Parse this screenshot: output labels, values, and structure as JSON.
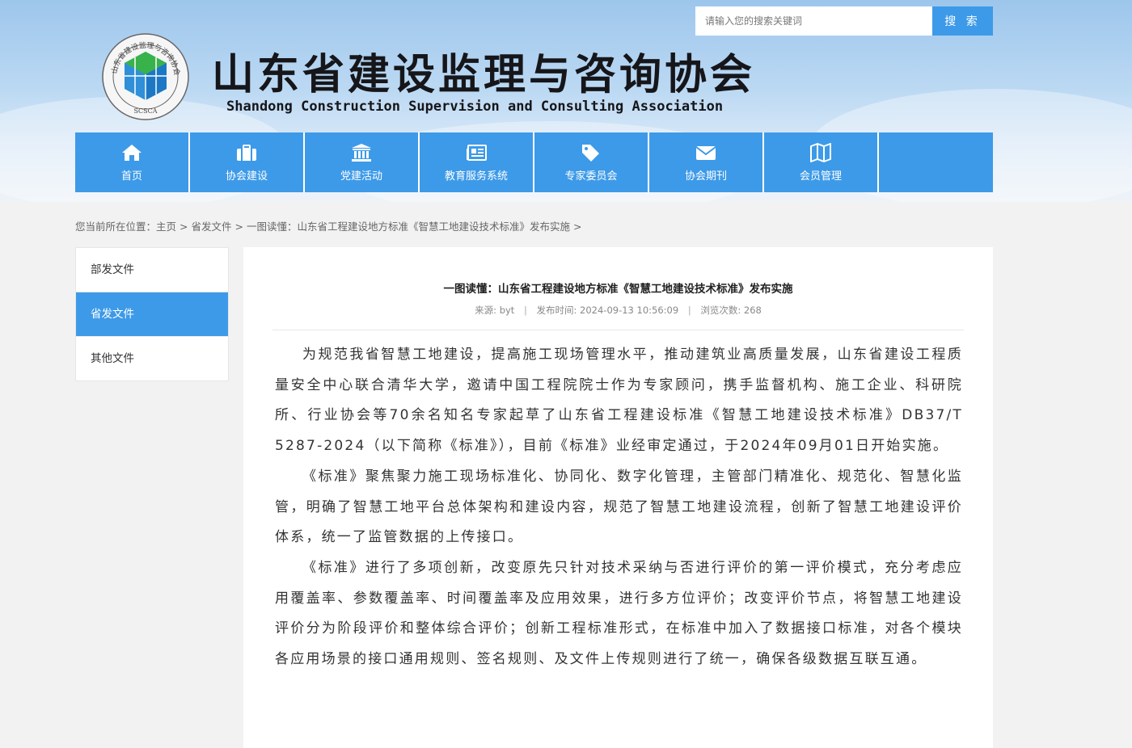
{
  "search": {
    "placeholder": "请输入您的搜索关键词",
    "button_label": "搜 索"
  },
  "header": {
    "logo_text": "山东省建设监理与咨询协会",
    "logo_abbr": "SCSCA",
    "title": "山东省建设监理与咨询协会",
    "subtitle": "Shandong Construction Supervision and Consulting Association"
  },
  "nav": {
    "items": [
      {
        "label": "首页",
        "icon": "home-icon"
      },
      {
        "label": "协会建设",
        "icon": "briefcase-icon"
      },
      {
        "label": "党建活动",
        "icon": "institution-icon"
      },
      {
        "label": "教育服务系统",
        "icon": "newspaper-icon"
      },
      {
        "label": "专家委员会",
        "icon": "tags-icon"
      },
      {
        "label": "协会期刊",
        "icon": "envelope-icon"
      },
      {
        "label": "会员管理",
        "icon": "map-icon"
      }
    ]
  },
  "breadcrumb": {
    "prefix": "您当前所在位置：",
    "home": "主页",
    "section": "省发文件",
    "current": "一图读懂：山东省工程建设地方标准《智慧工地建设技术标准》发布实施",
    "sep": ">"
  },
  "sidebar": {
    "items": [
      {
        "label": "部发文件",
        "active": false
      },
      {
        "label": "省发文件",
        "active": true
      },
      {
        "label": "其他文件",
        "active": false
      }
    ]
  },
  "article": {
    "title": "一图读懂：山东省工程建设地方标准《智慧工地建设技术标准》发布实施",
    "source_label": "来源:",
    "source": "byt",
    "time_label": "发布时间:",
    "time": "2024-09-13 10:56:09",
    "views_label": "浏览次数:",
    "views": "268",
    "paragraphs": [
      "为规范我省智慧工地建设，提高施工现场管理水平，推动建筑业高质量发展，山东省建设工程质量安全中心联合清华大学，邀请中国工程院院士作为专家顾问，携手监督机构、施工企业、科研院所、行业协会等70余名知名专家起草了山东省工程建设标准《智慧工地建设技术标准》DB37/T 5287-2024（以下简称《标准》），目前《标准》业经审定通过，于2024年09月01日开始实施。",
      "《标准》聚焦聚力施工现场标准化、协同化、数字化管理，主管部门精准化、规范化、智慧化监管，明确了智慧工地平台总体架构和建设内容，规范了智慧工地建设流程，创新了智慧工地建设评价体系，统一了监管数据的上传接口。",
      "《标准》进行了多项创新，改变原先只针对技术采纳与否进行评价的第一评价模式，充分考虑应用覆盖率、参数覆盖率、时间覆盖率及应用效果，进行多方位评价；改变评价节点，将智慧工地建设评价分为阶段评价和整体综合评价；创新工程标准形式，在标准中加入了数据接口标准，对各个模块各应用场景的接口通用规则、签名规则、及文件上传规则进行了统一，确保各级数据互联互通。"
    ]
  },
  "colors": {
    "accent": "#3d9ae8",
    "banner_top": "#9dc6ec",
    "page_bg": "#f2f2f2"
  }
}
